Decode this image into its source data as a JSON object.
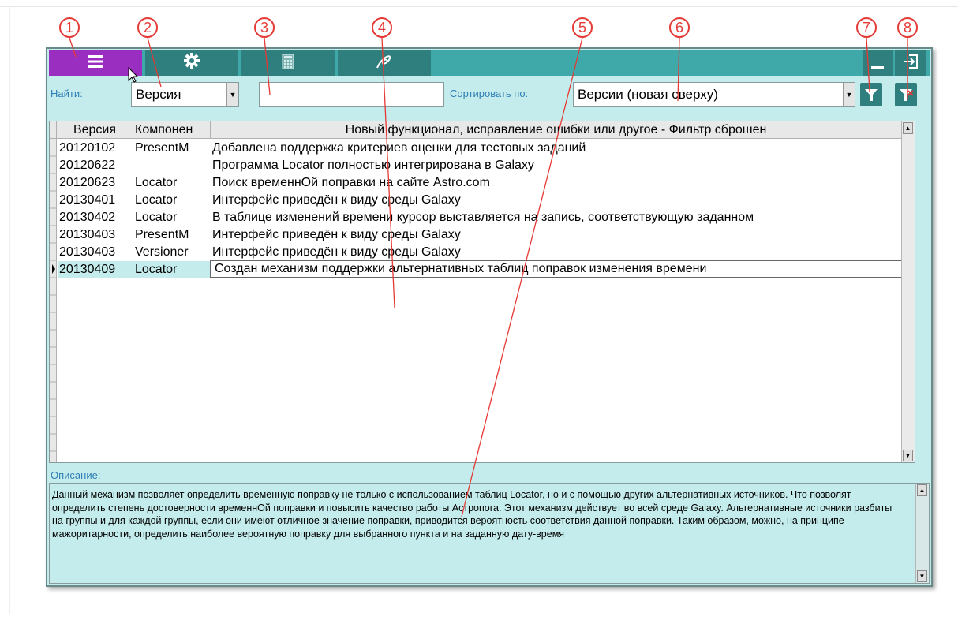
{
  "callouts": [
    "1",
    "2",
    "3",
    "4",
    "5",
    "6",
    "7",
    "8"
  ],
  "toolbar": {
    "buttons": [
      {
        "name": "menu",
        "icon": "list-icon"
      },
      {
        "name": "settings",
        "icon": "gear-icon"
      },
      {
        "name": "calculator",
        "icon": "calculator-icon"
      },
      {
        "name": "galaxy",
        "icon": "galaxy-logo-icon"
      }
    ],
    "right_buttons": [
      {
        "name": "minimize",
        "icon": "minimize-icon"
      },
      {
        "name": "exit",
        "icon": "exit-icon"
      }
    ]
  },
  "filter": {
    "find_label": "Найти:",
    "find_field_value": "Версия",
    "search_value": "",
    "sort_label": "Сортировать по:",
    "sort_value": "Версии (новая сверху)"
  },
  "grid": {
    "columns": [
      "Версия",
      "Компонен",
      "Новый функционал, исправление ошибки или другое - Фильтр сброшен"
    ],
    "rows": [
      {
        "version": "20120102",
        "component": "PresentM",
        "text": "Добавлена поддержка критериев оценки для тестовых заданий"
      },
      {
        "version": "20120622",
        "component": "",
        "text": "Программа Locator полностью интегрирована в Galaxy"
      },
      {
        "version": "20120623",
        "component": "Locator",
        "text": "Поиск временнОй поправки на сайте Astro.com"
      },
      {
        "version": "20130401",
        "component": "Locator",
        "text": "Интерфейс приведён к виду среды Galaxy"
      },
      {
        "version": "20130402",
        "component": "Locator",
        "text": "В таблице изменений времени курсор выставляется на запись, соответствующую заданном"
      },
      {
        "version": "20130403",
        "component": "PresentM",
        "text": "Интерфейс приведён к виду среды Galaxy"
      },
      {
        "version": "20130403",
        "component": "Versioner",
        "text": "Интерфейс приведён к виду среды Galaxy"
      },
      {
        "version": "20130409",
        "component": "Locator",
        "text": "Создан механизм поддержки альтернативных таблиц поправок изменения времени"
      }
    ]
  },
  "description": {
    "label": "Описание:",
    "text": "Данный механизм позволяет определить временную поправку не только с использованием таблиц Locator, но и с помощью других альтернативных источников. Что позволят определить степень достоверности временнОй поправки и повысить качество работы Астропога. Этот механизм действует во всей среде Galaxy. Альтернативные источники разбиты на группы и для каждой группы, если они имеют отличное значение поправки, приводится вероятность соответствия данной поправки. Таким образом, можно, на принципе мажоритарности, определить наиболее вероятную поправку для выбранного пункта и на заданную дату-время"
  }
}
